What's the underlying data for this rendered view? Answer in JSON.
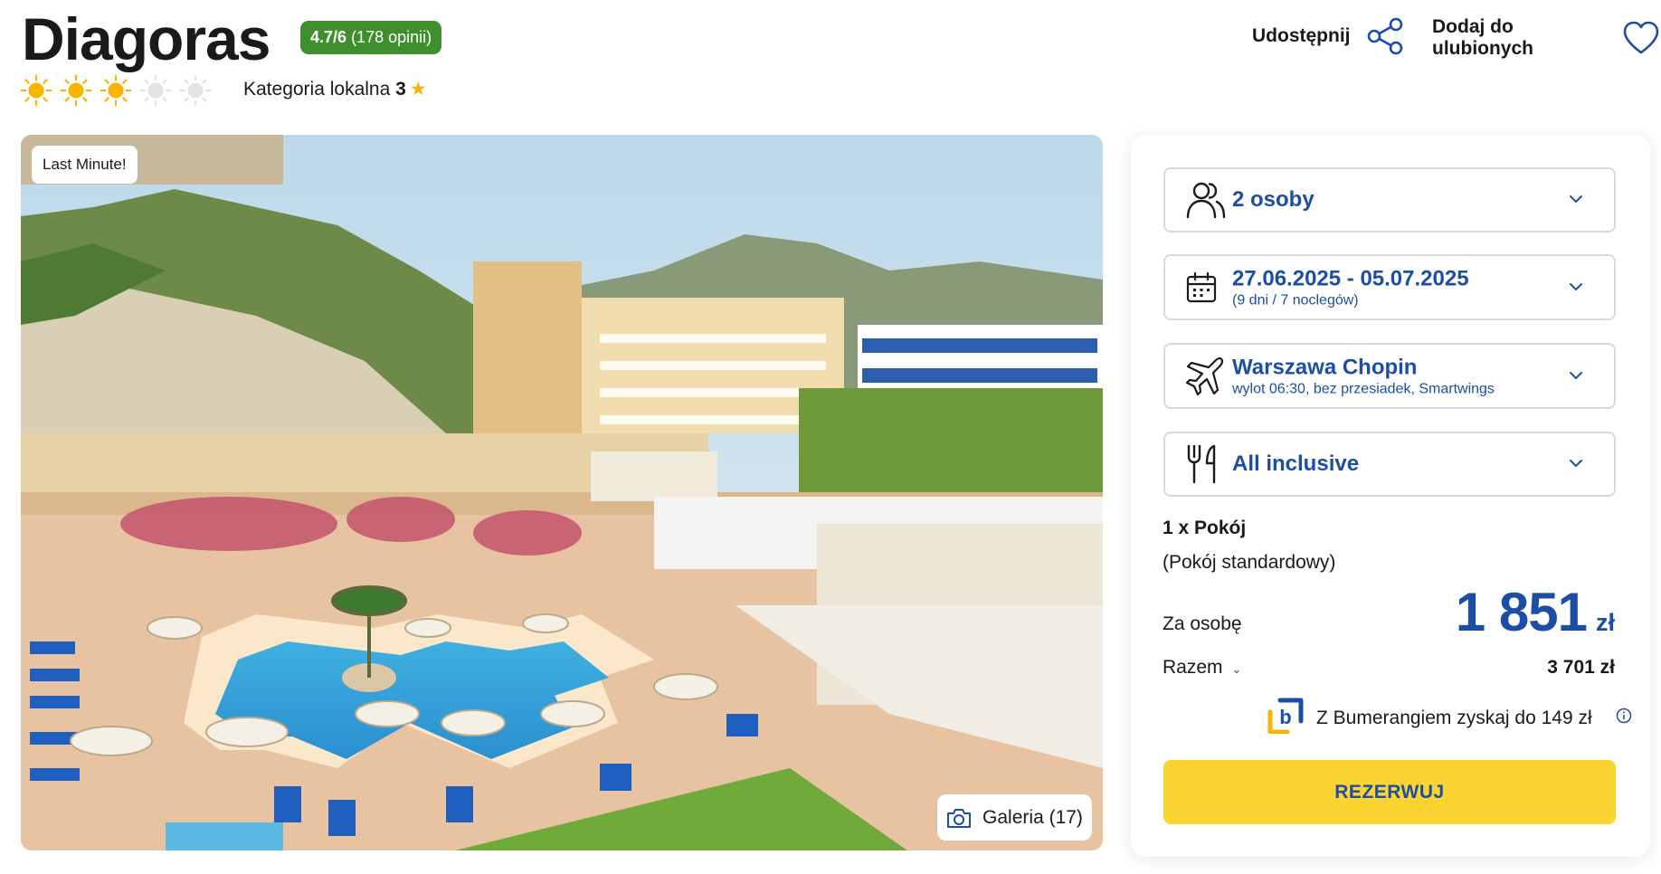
{
  "hotel": {
    "name": "Diagoras",
    "rating_score": "4.7/6",
    "rating_count": "(178 opinii)",
    "suns_filled": 3,
    "suns_total": 5,
    "local_category_label": "Kategoria lokalna",
    "local_category_value": "3"
  },
  "actions": {
    "share_label": "Udostępnij",
    "favorite_label": "Dodaj do ulubionych"
  },
  "photo": {
    "badge": "Last Minute!",
    "gallery_label": "Galeria (17)"
  },
  "booking": {
    "travelers": "2 osoby",
    "dates": "27.06.2025 - 05.07.2025",
    "dates_sub": "(9 dni / 7 noclegów)",
    "departure": "Warszawa Chopin",
    "departure_sub": "wylot 06:30, bez przesiadek, Smartwings",
    "board": "All inclusive",
    "room": "1 x Pokój",
    "room_type": "(Pokój standardowy)",
    "per_person_label": "Za osobę",
    "price": "1 851",
    "currency": "zł",
    "total_label": "Razem",
    "total_value": "3 701 zł",
    "bumerang_text": "Z Bumerangiem zyskaj do 149 zł",
    "book_label": "REZERWUJ"
  },
  "colors": {
    "brand_blue": "#1c4ea6",
    "rating_green": "#3f8f2f",
    "book_yellow": "#fcd431",
    "sun_yellow": "#f7b500"
  }
}
